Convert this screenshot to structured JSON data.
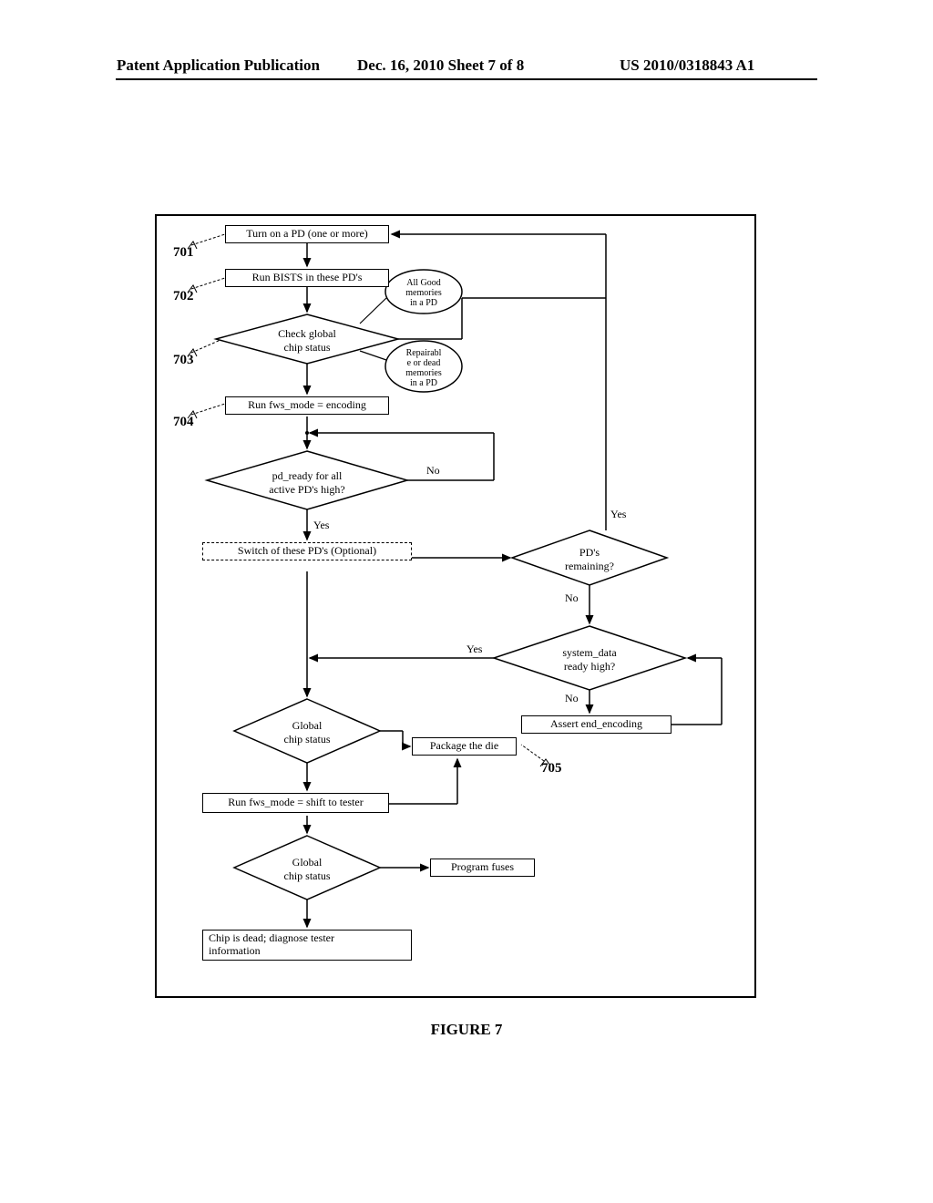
{
  "header": {
    "left": "Patent Application Publication",
    "center": "Dec. 16, 2010  Sheet 7 of 8",
    "right": "US 2010/0318843 A1"
  },
  "figure_caption": "FIGURE 7",
  "refs": {
    "r701": "701",
    "r702": "702",
    "r703": "703",
    "r704": "704",
    "r705": "705"
  },
  "nodes": {
    "turn_on": "Turn on a PD (one or more)",
    "run_bists": "Run BISTS in these PD's",
    "check_global": "Check global\nchip status",
    "callout_good": "All Good\nmemories\nin a PD",
    "callout_repair": "Repairabl\ne or dead\nmemories\nin a PD",
    "run_fws_enc": "Run fws_mode = encoding",
    "pd_ready": "pd_ready for all\nactive PD's high?",
    "switch_off": "Switch of these PD's (Optional)",
    "pds_remaining": "PD's\nremaining?",
    "system_data": "system_data\nready high?",
    "assert_end": "Assert end_encoding",
    "global_status1": "Global\nchip status",
    "package_die": "Package the die",
    "run_fws_shift": "Run fws_mode = shift to tester",
    "global_status2": "Global\nchip status",
    "program_fuses": "Program fuses",
    "chip_dead": "Chip is dead; diagnose tester\ninformation"
  },
  "labels": {
    "yes": "Yes",
    "no": "No"
  }
}
